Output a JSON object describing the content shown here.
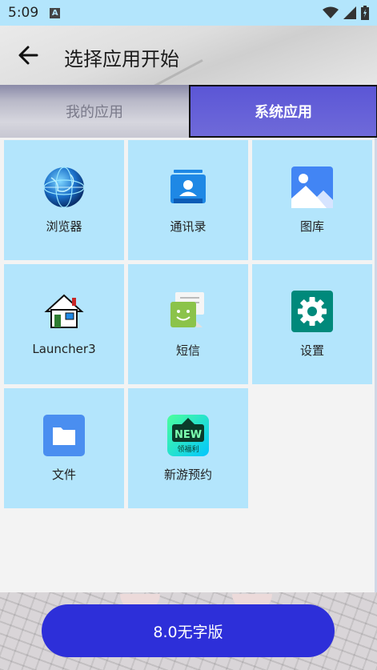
{
  "status_bar": {
    "time": "5:09",
    "notification_letter": "A",
    "icons": [
      "wifi-icon",
      "signal-icon",
      "battery-icon"
    ]
  },
  "header": {
    "title": "选择应用开始",
    "back_icon": "arrow-left-icon"
  },
  "tabs": [
    {
      "label": "我的应用",
      "selected": false
    },
    {
      "label": "系统应用",
      "selected": true
    }
  ],
  "apps": [
    {
      "label": "浏览器",
      "icon": "globe-icon"
    },
    {
      "label": "通讯录",
      "icon": "contacts-icon"
    },
    {
      "label": "图库",
      "icon": "gallery-icon"
    },
    {
      "label": "Launcher3",
      "icon": "home-launcher-icon"
    },
    {
      "label": "短信",
      "icon": "messages-icon"
    },
    {
      "label": "设置",
      "icon": "settings-gear-icon"
    },
    {
      "label": "文件",
      "icon": "folder-icon"
    },
    {
      "label": "新游预约",
      "icon": "new-game-icon",
      "badge_text": "NEW",
      "badge_sub": "领福利"
    }
  ],
  "footer": {
    "button_label": "8.0无字版"
  },
  "colors": {
    "status_bar": "#b3e5fc",
    "tile": "#b3e5fc",
    "tab_active": "#6f6ad9",
    "footer_button": "#2d2fd9"
  }
}
